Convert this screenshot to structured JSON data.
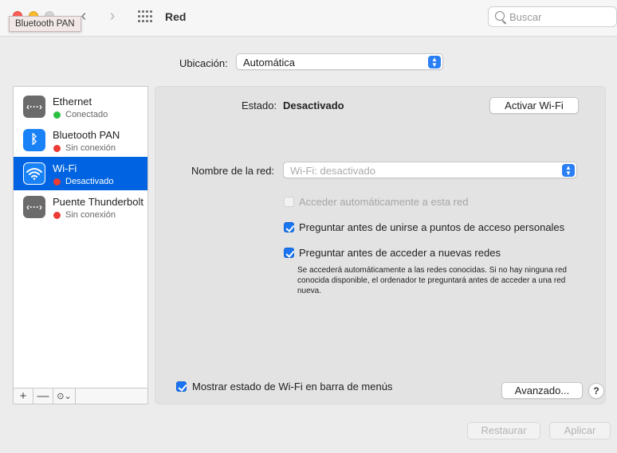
{
  "window": {
    "title": "Red",
    "tooltip": "Bluetooth PAN"
  },
  "search": {
    "placeholder": "Buscar"
  },
  "location": {
    "label": "Ubicación:",
    "value": "Automática"
  },
  "services": [
    {
      "name": "Ethernet",
      "status": "Conectado",
      "status_color": "#2bc140",
      "icon": "ethernet-icon"
    },
    {
      "name": "Bluetooth PAN",
      "status": "Sin conexión",
      "status_color": "#ec3b35",
      "icon": "bluetooth-icon"
    },
    {
      "name": "Wi-Fi",
      "status": "Desactivado",
      "status_color": "#ec3b35",
      "icon": "wifi-icon",
      "selected": true
    },
    {
      "name": "Puente Thunderbolt",
      "status": "Sin conexión",
      "status_color": "#ec3b35",
      "icon": "thunderbolt-bridge-icon"
    }
  ],
  "sidebar_tools": {
    "add": "+",
    "remove": "—",
    "action": "⊙⌄"
  },
  "detail": {
    "status_label": "Estado:",
    "status_value": "Desactivado",
    "activate_button": "Activar Wi-Fi",
    "network_name_label": "Nombre de la red:",
    "network_name_placeholder": "Wi-Fi: desactivado",
    "auto_join_label": "Acceder automáticamente a esta red",
    "ask_hotspots_label": "Preguntar antes de unirse a puntos de acceso personales",
    "ask_new_networks_label": "Preguntar antes de acceder a nuevas redes",
    "note": "Se accederá automáticamente a las redes conocidas. Si no hay ninguna red conocida disponible, el ordenador te preguntará antes de acceder a una red nueva.",
    "show_status_label": "Mostrar estado de Wi-Fi en barra de menús",
    "advanced_button": "Avanzado...",
    "help_button": "?"
  },
  "footer": {
    "revert_button": "Restaurar",
    "apply_button": "Aplicar"
  },
  "colors": {
    "accent": "#1a74f0",
    "selection": "#0063e1"
  }
}
